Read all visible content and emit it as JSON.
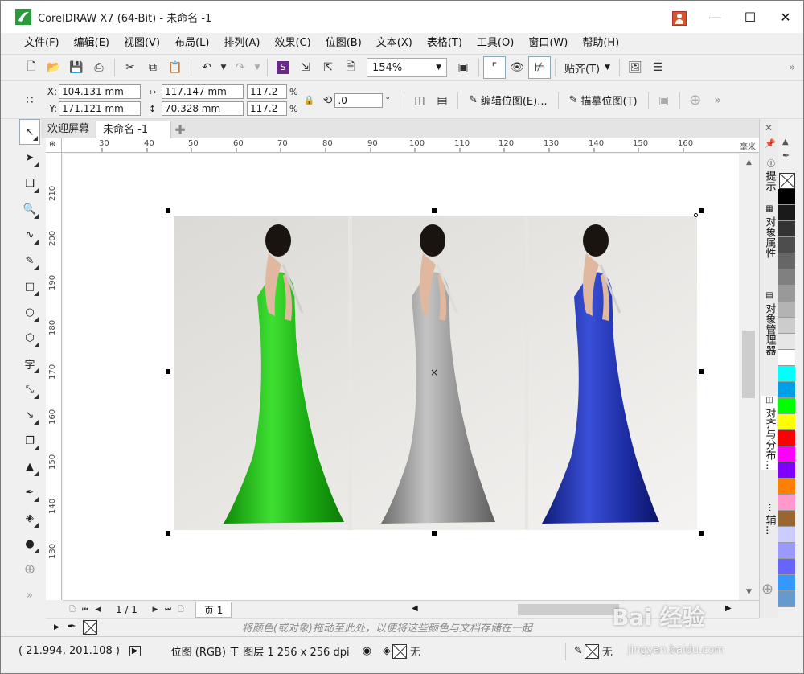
{
  "window": {
    "title": "CorelDRAW X7 (64-Bit) - 未命名 -1"
  },
  "menu": [
    "文件(F)",
    "编辑(E)",
    "视图(V)",
    "布局(L)",
    "排列(A)",
    "效果(C)",
    "位图(B)",
    "文本(X)",
    "表格(T)",
    "工具(O)",
    "窗口(W)",
    "帮助(H)"
  ],
  "toolbar": {
    "zoom_value": "154%",
    "snap_label": "贴齐(T)"
  },
  "properties": {
    "x_label": "X:",
    "x_value": "104.131 mm",
    "y_label": "Y:",
    "y_value": "171.121 mm",
    "width_value": "117.147 mm",
    "height_value": "70.328 mm",
    "scale_w": "117.2",
    "scale_h": "117.2",
    "pct": "%",
    "rotation_value": ".0",
    "degree": "°",
    "edit_bitmap_label": "编辑位图(E)...",
    "trace_bitmap_label": "描摹位图(T)"
  },
  "tabs": {
    "welcome": "欢迎屏幕",
    "document": "未命名 -1"
  },
  "ruler": {
    "unit": "毫米",
    "h_ticks": [
      "30",
      "40",
      "50",
      "60",
      "70",
      "80",
      "90",
      "100",
      "110",
      "120",
      "130",
      "140",
      "150",
      "160"
    ],
    "v_ticks": [
      "210",
      "200",
      "190",
      "180",
      "170",
      "160",
      "150",
      "140",
      "130"
    ]
  },
  "pages": {
    "counter": "1 / 1",
    "tab": "页 1"
  },
  "doc_palette": {
    "hint": "将颜色(或对象)拖动至此处，以便将这些颜色与文档存储在一起"
  },
  "status": {
    "coords": "( 21.994, 201.108 )",
    "object_info": "位图 (RGB) 于 图层 1 256 x 256 dpi",
    "fill_none": "无",
    "outline_none": "无"
  },
  "dockers": [
    "提示",
    "对象属性",
    "对象管理器",
    "对齐与分布...",
    "辅..."
  ],
  "palette_colors": [
    "#000000",
    "#1a1a1a",
    "#333333",
    "#4d4d4d",
    "#666666",
    "#808080",
    "#999999",
    "#b3b3b3",
    "#cccccc",
    "#e6e6e6",
    "#ffffff",
    "#00ffff",
    "#00a0e9",
    "#00ff00",
    "#ffff00",
    "#ff0000",
    "#ff00ff",
    "#8000ff",
    "#ff8000",
    "#ff99cc",
    "#996633",
    "#ccccff",
    "#9999ff",
    "#6666ff",
    "#3399ff",
    "#6699cc"
  ],
  "dress_colors": {
    "green": "#22c414",
    "gray": "#9a9a9a",
    "blue": "#1f2fa8"
  },
  "watermark": {
    "logo": "Bai  经验",
    "url": "jingyan.baidu.com"
  }
}
